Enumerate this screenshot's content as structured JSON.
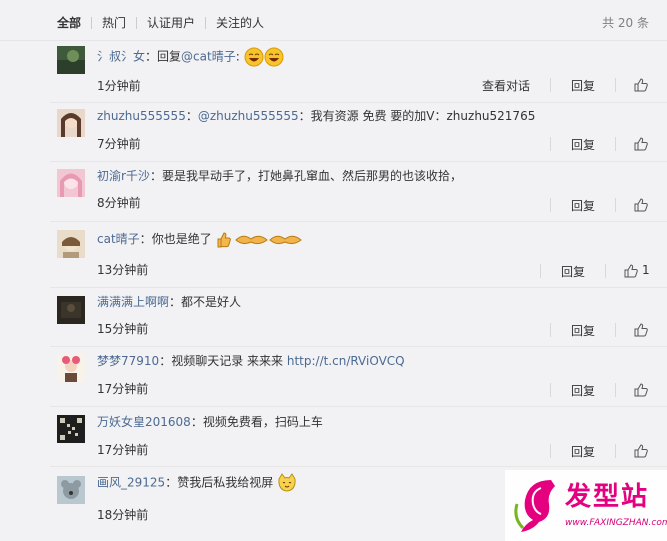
{
  "filter": {
    "tabs": [
      "全部",
      "热门",
      "认证用户",
      "关注的人"
    ],
    "total": "共 20 条"
  },
  "comments": [
    {
      "user": "氵叔氵女",
      "sep": "：",
      "text": "回复",
      "mention": "@cat晴子",
      "text2": ":",
      "time": "1分钟前",
      "view": "查看对话",
      "reply": "回复",
      "likes": ""
    },
    {
      "user": "zhuzhu555555",
      "sep": "：",
      "mention": "@zhuzhu555555",
      "text": "：我有资源 免费 要的加V：zhuzhu521765",
      "time": "7分钟前",
      "reply": "回复",
      "likes": ""
    },
    {
      "user": "初渝r千沙",
      "sep": "：",
      "text": "要是我早动手了，打她鼻孔窜血、然后那男的也该收拾，",
      "time": "8分钟前",
      "reply": "回复",
      "likes": ""
    },
    {
      "user": "cat晴子",
      "sep": "：",
      "text": "你也是绝了",
      "time": "13分钟前",
      "reply": "回复",
      "likes": "1"
    },
    {
      "user": "满满满上啊啊",
      "sep": "：",
      "text": "都不是好人",
      "time": "15分钟前",
      "reply": "回复",
      "likes": ""
    },
    {
      "user": "梦梦77910",
      "sep": "：",
      "text": "视频聊天记录 来来来 ",
      "link": "http://t.cn/RViOVCQ",
      "time": "17分钟前",
      "reply": "回复",
      "likes": ""
    },
    {
      "user": "万妖女皇201608",
      "sep": "：",
      "text": "视频免费看，扫码上车",
      "time": "17分钟前",
      "reply": "回复",
      "likes": ""
    },
    {
      "user": "画风_29125",
      "sep": "：",
      "text": "赞我后私我给视屏",
      "time": "18分钟前",
      "reply": "回复",
      "likes": ""
    }
  ],
  "watermark": {
    "brand": "发型站",
    "url": "www.FAXINGZHAN.com"
  },
  "colors": {
    "link": "#4c6a91",
    "text": "#333333",
    "bg": "#f2f2f5",
    "watermark": "#e4007f"
  }
}
